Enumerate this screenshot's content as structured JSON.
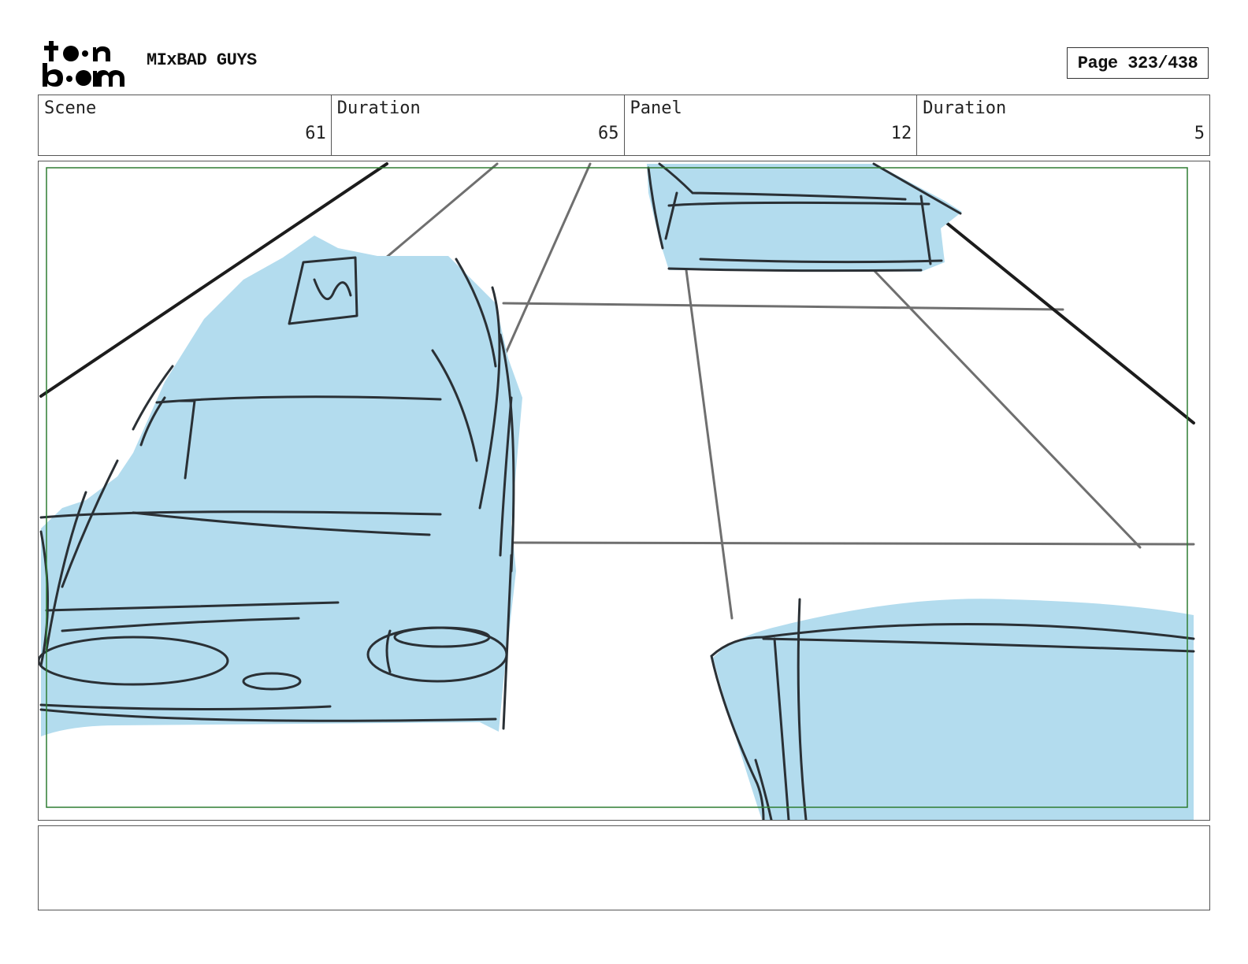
{
  "header": {
    "logo_text": "toon boom",
    "project_title": "MIxBAD GUYS",
    "page_label": "Page 323/438"
  },
  "info": [
    {
      "label": "Scene",
      "value": "61"
    },
    {
      "label": "Duration",
      "value": "65"
    },
    {
      "label": "Panel",
      "value": "12"
    },
    {
      "label": "Duration",
      "value": "5"
    }
  ],
  "panel": {
    "fill_color": "#b3dcee",
    "line_color": "#2a3035",
    "guide_color": "#2e7d32"
  },
  "notes": {
    "text": ""
  }
}
